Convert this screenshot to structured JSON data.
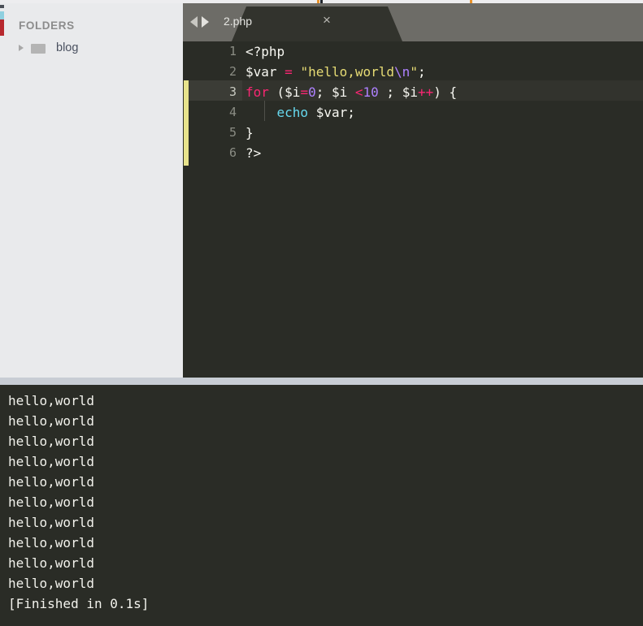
{
  "window": {
    "background_color": "#2a2c26"
  },
  "sidebar": {
    "heading": "FOLDERS",
    "items": [
      {
        "label": "blog",
        "icon": "folder-icon",
        "disclosure": "collapsed-triangle-icon"
      }
    ]
  },
  "editor": {
    "nav": {
      "back_icon": "arrow-left-icon",
      "forward_icon": "arrow-right-icon"
    },
    "tabs": [
      {
        "label": "2.php",
        "active": true,
        "close_icon": "×"
      }
    ],
    "active_line": 3,
    "gutter_numbers": [
      "1",
      "2",
      "3",
      "4",
      "5",
      "6"
    ],
    "code": {
      "language": "php",
      "lines": [
        {
          "n": "1",
          "tokens": [
            {
              "t": "<?php",
              "c": "t-punc"
            }
          ]
        },
        {
          "n": "2",
          "tokens": [
            {
              "t": "$var",
              "c": "t-var"
            },
            {
              "t": " ",
              "c": "t-punc"
            },
            {
              "t": "=",
              "c": "t-op"
            },
            {
              "t": " ",
              "c": "t-punc"
            },
            {
              "t": "\"hello,world",
              "c": "t-str"
            },
            {
              "t": "\\n",
              "c": "t-esc"
            },
            {
              "t": "\"",
              "c": "t-str"
            },
            {
              "t": ";",
              "c": "t-punc"
            }
          ]
        },
        {
          "n": "3",
          "tokens": [
            {
              "t": "for",
              "c": "t-kw"
            },
            {
              "t": " ($i",
              "c": "t-punc"
            },
            {
              "t": "=",
              "c": "t-op"
            },
            {
              "t": "0",
              "c": "t-num"
            },
            {
              "t": "; $i ",
              "c": "t-punc"
            },
            {
              "t": "<",
              "c": "t-op"
            },
            {
              "t": "10",
              "c": "t-num"
            },
            {
              "t": " ; $i",
              "c": "t-punc"
            },
            {
              "t": "++",
              "c": "t-op"
            },
            {
              "t": ") {",
              "c": "t-punc"
            }
          ]
        },
        {
          "n": "4",
          "tokens": [
            {
              "t": "    ",
              "c": "t-punc"
            },
            {
              "t": "echo",
              "c": "t-fn"
            },
            {
              "t": " $var;",
              "c": "t-punc"
            }
          ]
        },
        {
          "n": "5",
          "tokens": [
            {
              "t": "}",
              "c": "t-punc"
            }
          ]
        },
        {
          "n": "6",
          "tokens": [
            {
              "t": "?>",
              "c": "t-punc"
            }
          ]
        }
      ],
      "plain_text": "<?php\n$var = \"hello,world\\n\";\nfor ($i=0; $i <10 ; $i++) {\n    echo $var;\n}\n?>"
    }
  },
  "output_panel": {
    "lines": [
      "hello,world",
      "hello,world",
      "hello,world",
      "hello,world",
      "hello,world",
      "hello,world",
      "hello,world",
      "hello,world",
      "hello,world",
      "hello,world",
      "[Finished in 0.1s]"
    ],
    "status": "[Finished in 0.1s]",
    "run_time": "0.1s"
  },
  "colors": {
    "editor_bg": "#2a2c26",
    "tabbar_bg": "#6d6c67",
    "active_tab_bg": "#32332d",
    "sidebar_bg": "#e9eaec",
    "divider": "#c8cdd4",
    "keyword": "#f92672",
    "string": "#e6db74",
    "number": "#ae81ff",
    "function": "#66d9ef",
    "text": "#f8f8f2",
    "marker_yellow": "#e7e38c"
  }
}
